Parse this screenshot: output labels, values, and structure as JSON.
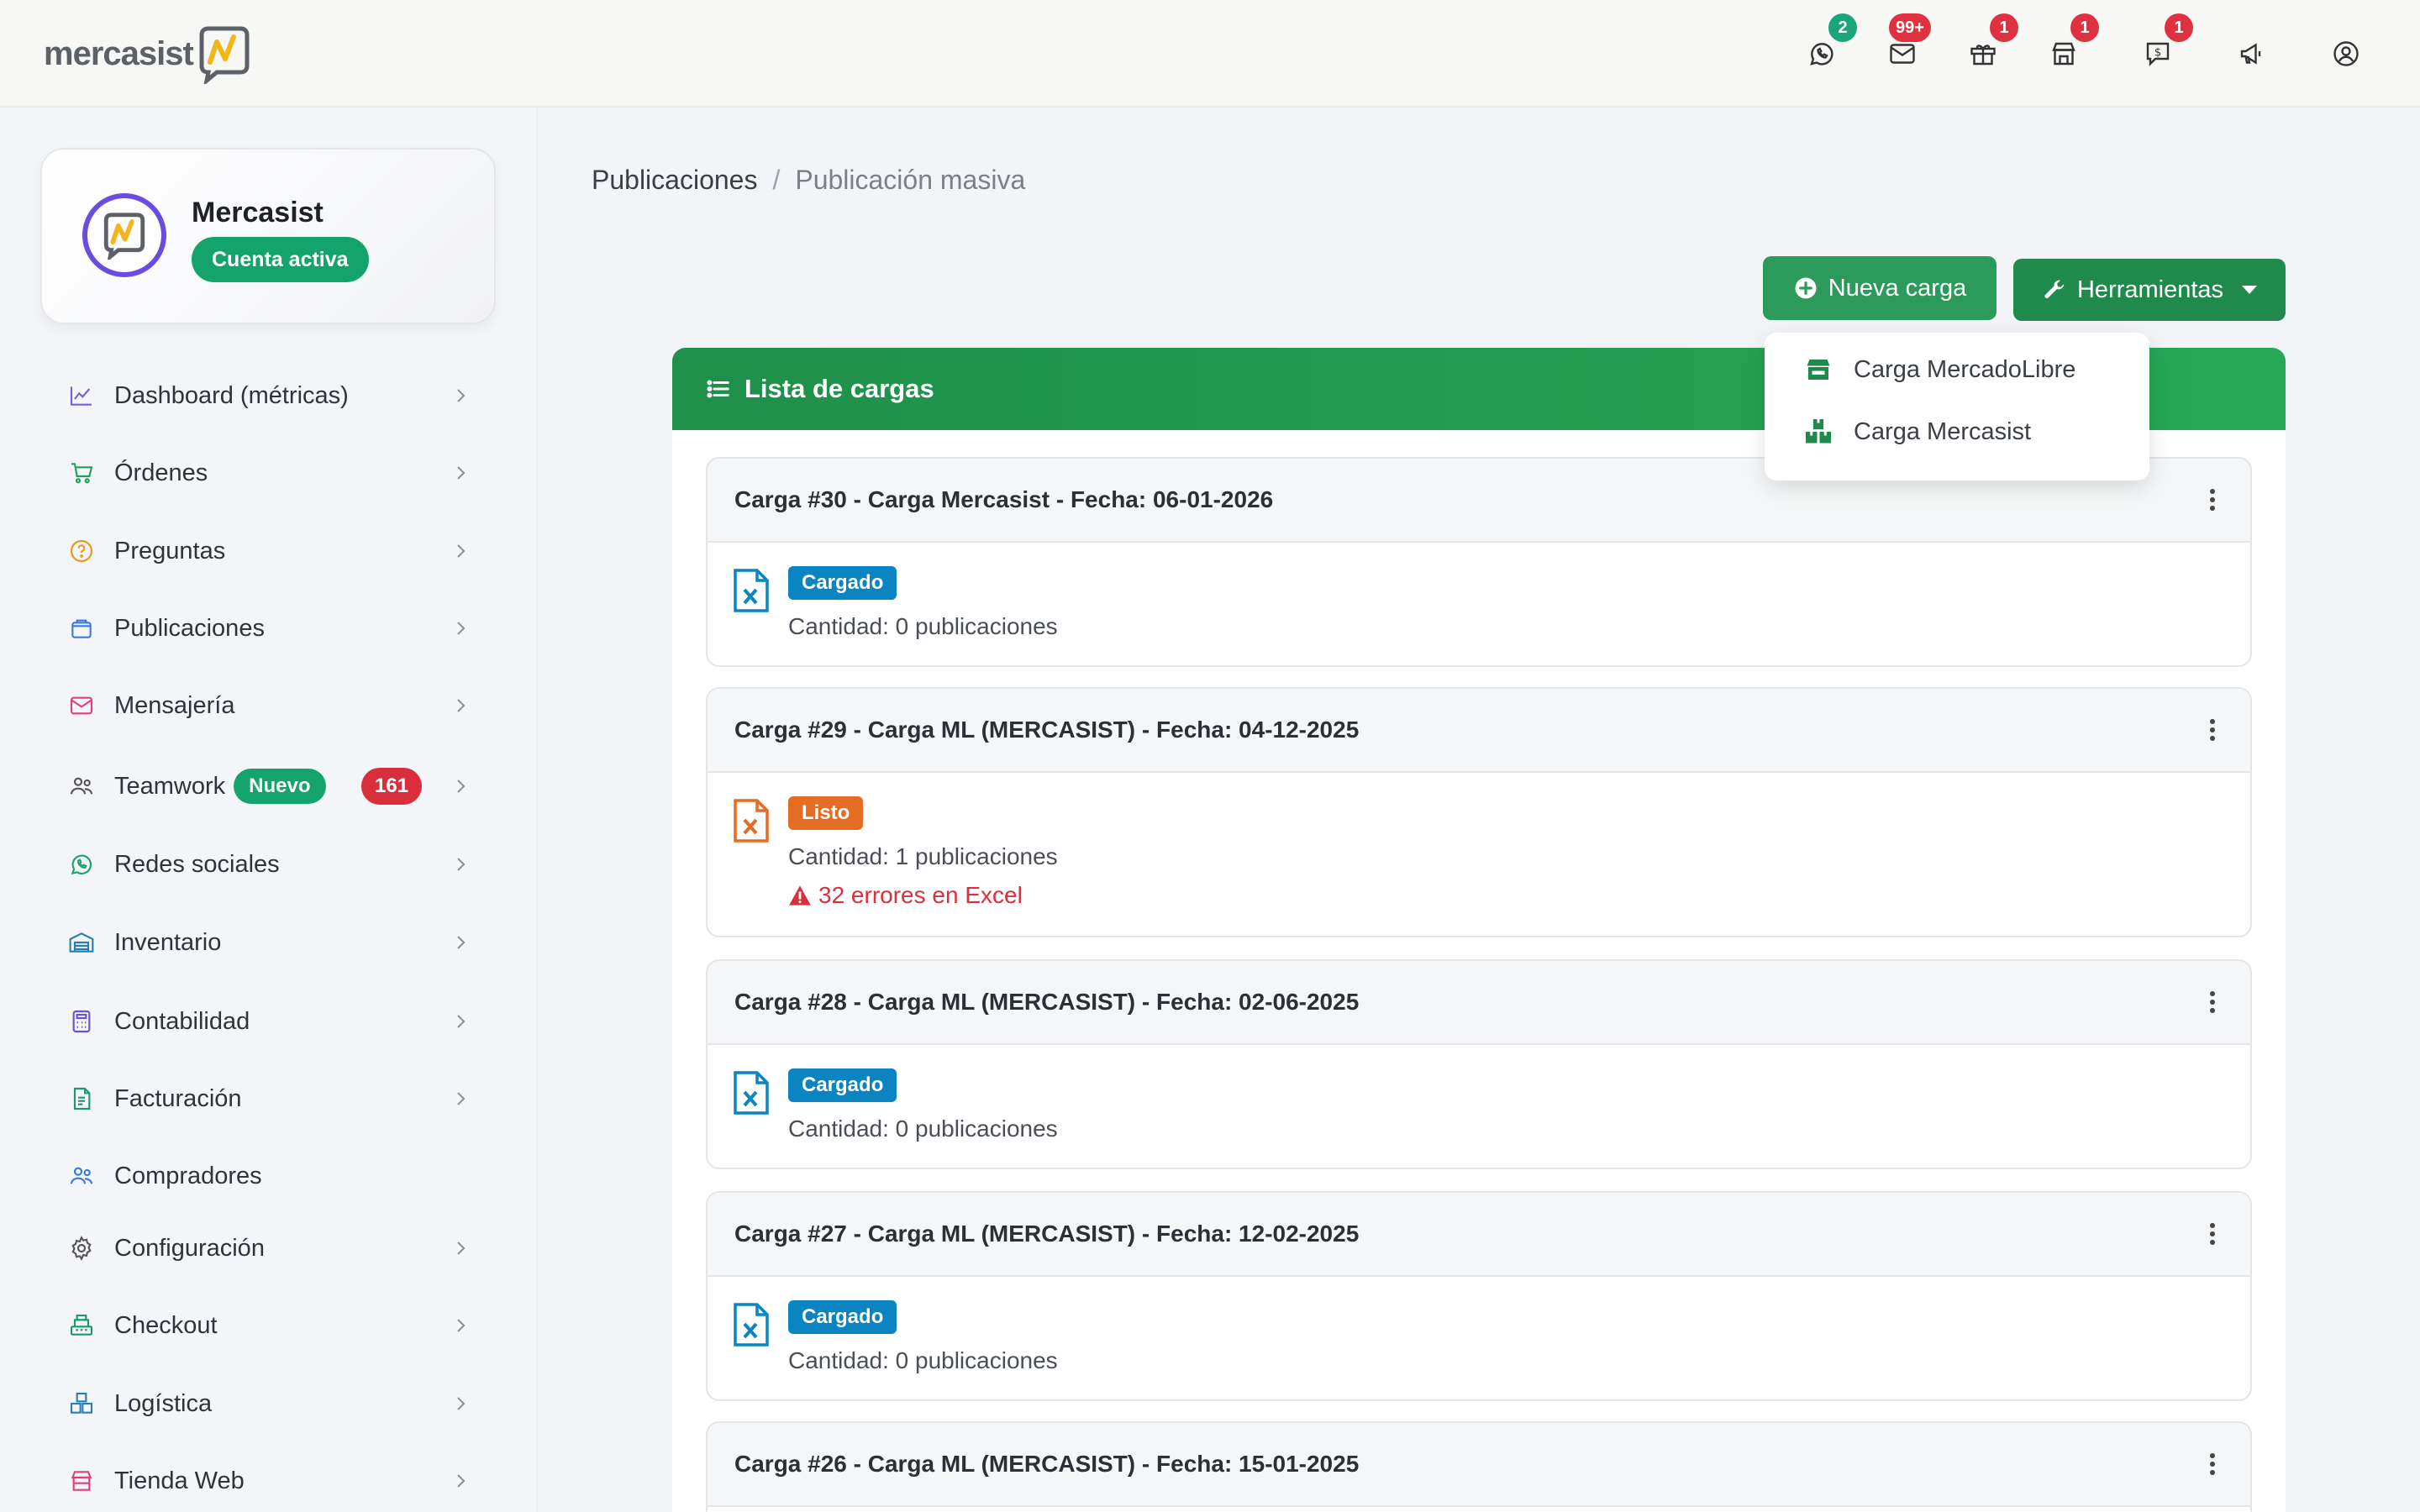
{
  "topbar": {
    "logo_text": "mercasist",
    "icons": [
      {
        "name": "whatsapp-icon",
        "badge": "2",
        "badge_color": "#1aa67a"
      },
      {
        "name": "mail-icon",
        "badge": "99+",
        "badge_color": "#e03140"
      },
      {
        "name": "gift-box-icon",
        "badge": "1",
        "badge_color": "#e03140"
      },
      {
        "name": "store-icon",
        "badge": "1",
        "badge_color": "#e03140"
      },
      {
        "name": "dollar-chat-icon",
        "badge": "1",
        "badge_color": "#e03140"
      },
      {
        "name": "megaphone-icon",
        "badge": "",
        "badge_color": ""
      },
      {
        "name": "user-account-icon",
        "badge": "",
        "badge_color": ""
      }
    ]
  },
  "account": {
    "name": "Mercasist",
    "status": "Cuenta activa"
  },
  "sidebar": {
    "items": [
      {
        "label": "Dashboard (métricas)",
        "icon": "chart-line-icon"
      },
      {
        "label": "Órdenes",
        "icon": "cart-icon"
      },
      {
        "label": "Preguntas",
        "icon": "question-icon"
      },
      {
        "label": "Publicaciones",
        "icon": "bag-icon"
      },
      {
        "label": "Mensajería",
        "icon": "envelope-icon"
      },
      {
        "label": "Teamwork",
        "icon": "team-icon",
        "tag": "Nuevo",
        "count": "161"
      },
      {
        "label": "Redes sociales",
        "icon": "whatsapp-icon"
      },
      {
        "label": "Inventario",
        "icon": "warehouse-icon"
      },
      {
        "label": "Contabilidad",
        "icon": "calculator-icon"
      },
      {
        "label": "Facturación",
        "icon": "invoice-icon"
      },
      {
        "label": "Compradores",
        "icon": "buyers-icon"
      },
      {
        "label": "Configuración",
        "icon": "gear-icon"
      },
      {
        "label": "Checkout",
        "icon": "register-icon"
      },
      {
        "label": "Logística",
        "icon": "boxes-icon"
      },
      {
        "label": "Tienda Web",
        "icon": "shop-icon"
      }
    ]
  },
  "breadcrumb": {
    "parent": "Publicaciones",
    "separator": "/",
    "current": "Publicación masiva"
  },
  "actions": {
    "new_label": "Nueva carga",
    "tools_label": "Herramientas"
  },
  "dropdown": {
    "items": [
      {
        "label": "Carga MercadoLibre",
        "icon": "store-icon"
      },
      {
        "label": "Carga Mercasist",
        "icon": "boxes-icon"
      }
    ]
  },
  "list": {
    "title": "Lista de cargas",
    "cards": [
      {
        "title": "Carga #30 - Carga Mercasist - Fecha: 06-01-2026",
        "status": "Cargado",
        "status_color": "#0b84c2",
        "qty": "Cantidad: 0 publicaciones",
        "error": ""
      },
      {
        "title": "Carga #29 - Carga ML (MERCASIST) - Fecha: 04-12-2025",
        "status": "Listo",
        "status_color": "#e56d23",
        "qty": "Cantidad: 1 publicaciones",
        "error": "32 errores en Excel"
      },
      {
        "title": "Carga #28 - Carga ML (MERCASIST) - Fecha: 02-06-2025",
        "status": "Cargado",
        "status_color": "#0b84c2",
        "qty": "Cantidad: 0 publicaciones",
        "error": ""
      },
      {
        "title": "Carga #27 - Carga ML (MERCASIST) - Fecha: 12-02-2025",
        "status": "Cargado",
        "status_color": "#0b84c2",
        "qty": "Cantidad: 0 publicaciones",
        "error": ""
      },
      {
        "title": "Carga #26 - Carga ML (MERCASIST) - Fecha: 15-01-2025",
        "status": "",
        "status_color": "",
        "qty": "",
        "error": ""
      }
    ]
  }
}
